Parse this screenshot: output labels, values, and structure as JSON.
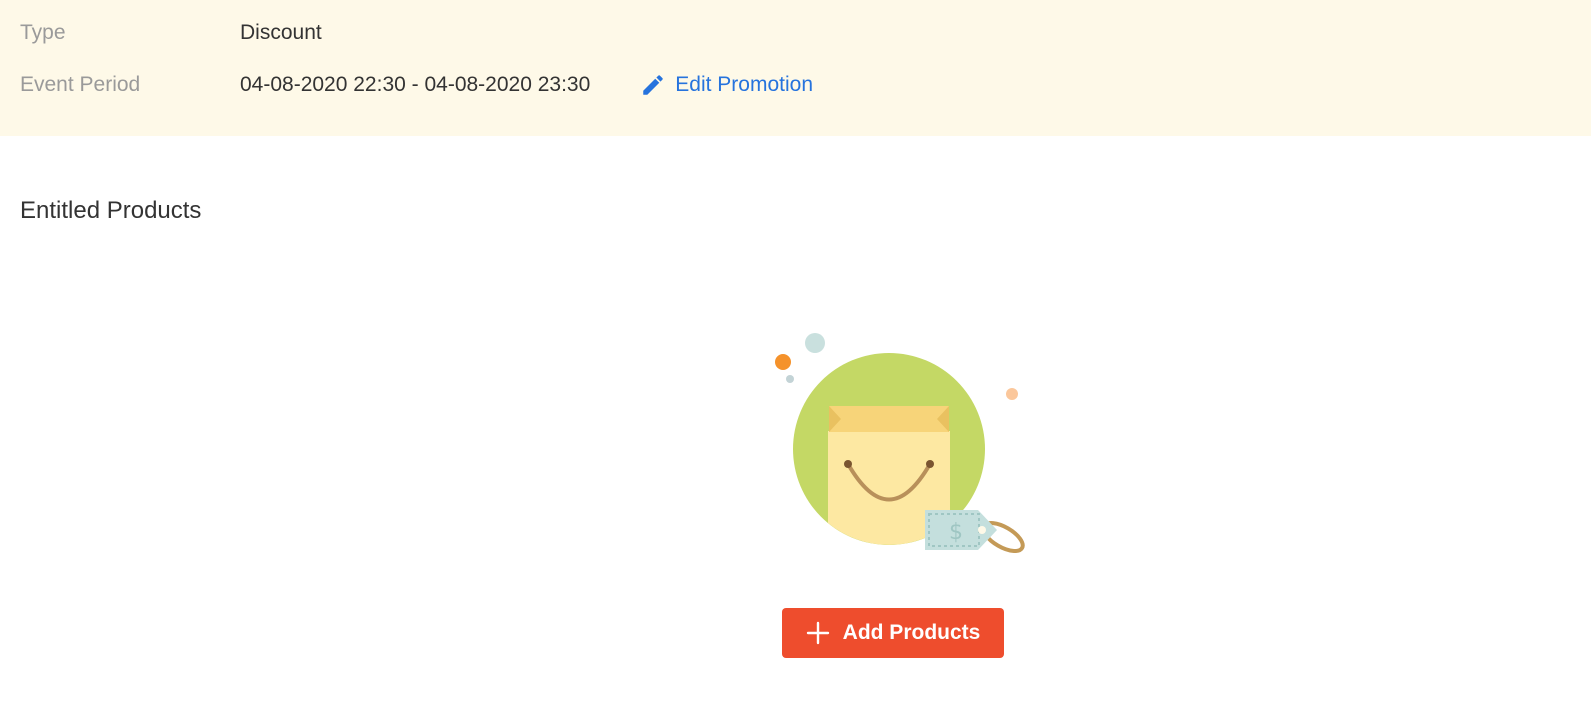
{
  "promotion_info": {
    "type_label": "Type",
    "type_value": "Discount",
    "period_label": "Event Period",
    "period_value": "04-08-2020 22:30 - 04-08-2020 23:30",
    "edit_label": "Edit Promotion",
    "edit_icon": "pencil-icon"
  },
  "entitled_products": {
    "title": "Entitled Products",
    "illustration_icon": "shopping-bag-icon",
    "add_button_label": "Add Products",
    "add_button_icon": "plus-icon"
  },
  "colors": {
    "panel_background": "#fef9e8",
    "link": "#2673dd",
    "primary_button": "#ee4d2d",
    "label": "#9a9a9a",
    "text": "#333333"
  }
}
